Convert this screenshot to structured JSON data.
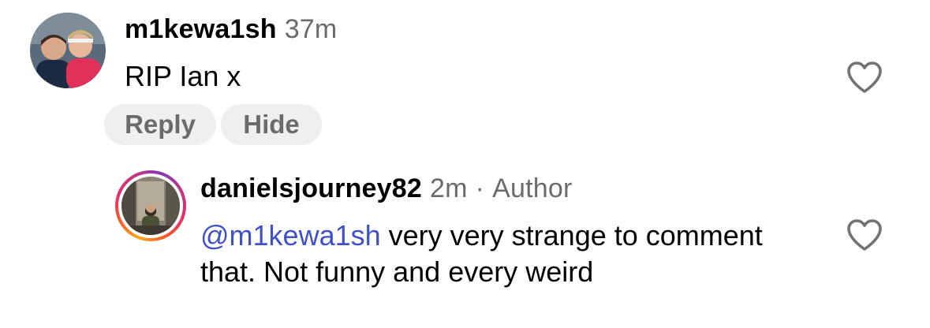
{
  "comments": [
    {
      "username": "m1kewa1sh",
      "time": "37m",
      "text": "RIP Ian x",
      "actions": {
        "reply": "Reply",
        "hide": "Hide"
      },
      "like_icon": "heart-outline-icon"
    },
    {
      "username": "danielsjourney82",
      "time": "2m",
      "separator": "·",
      "role": "Author",
      "mention": "@m1kewa1sh",
      "text": " very very strange to comment that. Not funny and every weird",
      "like_icon": "heart-outline-icon",
      "story_ring": true
    }
  ],
  "colors": {
    "mention": "#3f51c7",
    "meta": "#6b6b6b",
    "pill_bg": "#efeff2"
  }
}
